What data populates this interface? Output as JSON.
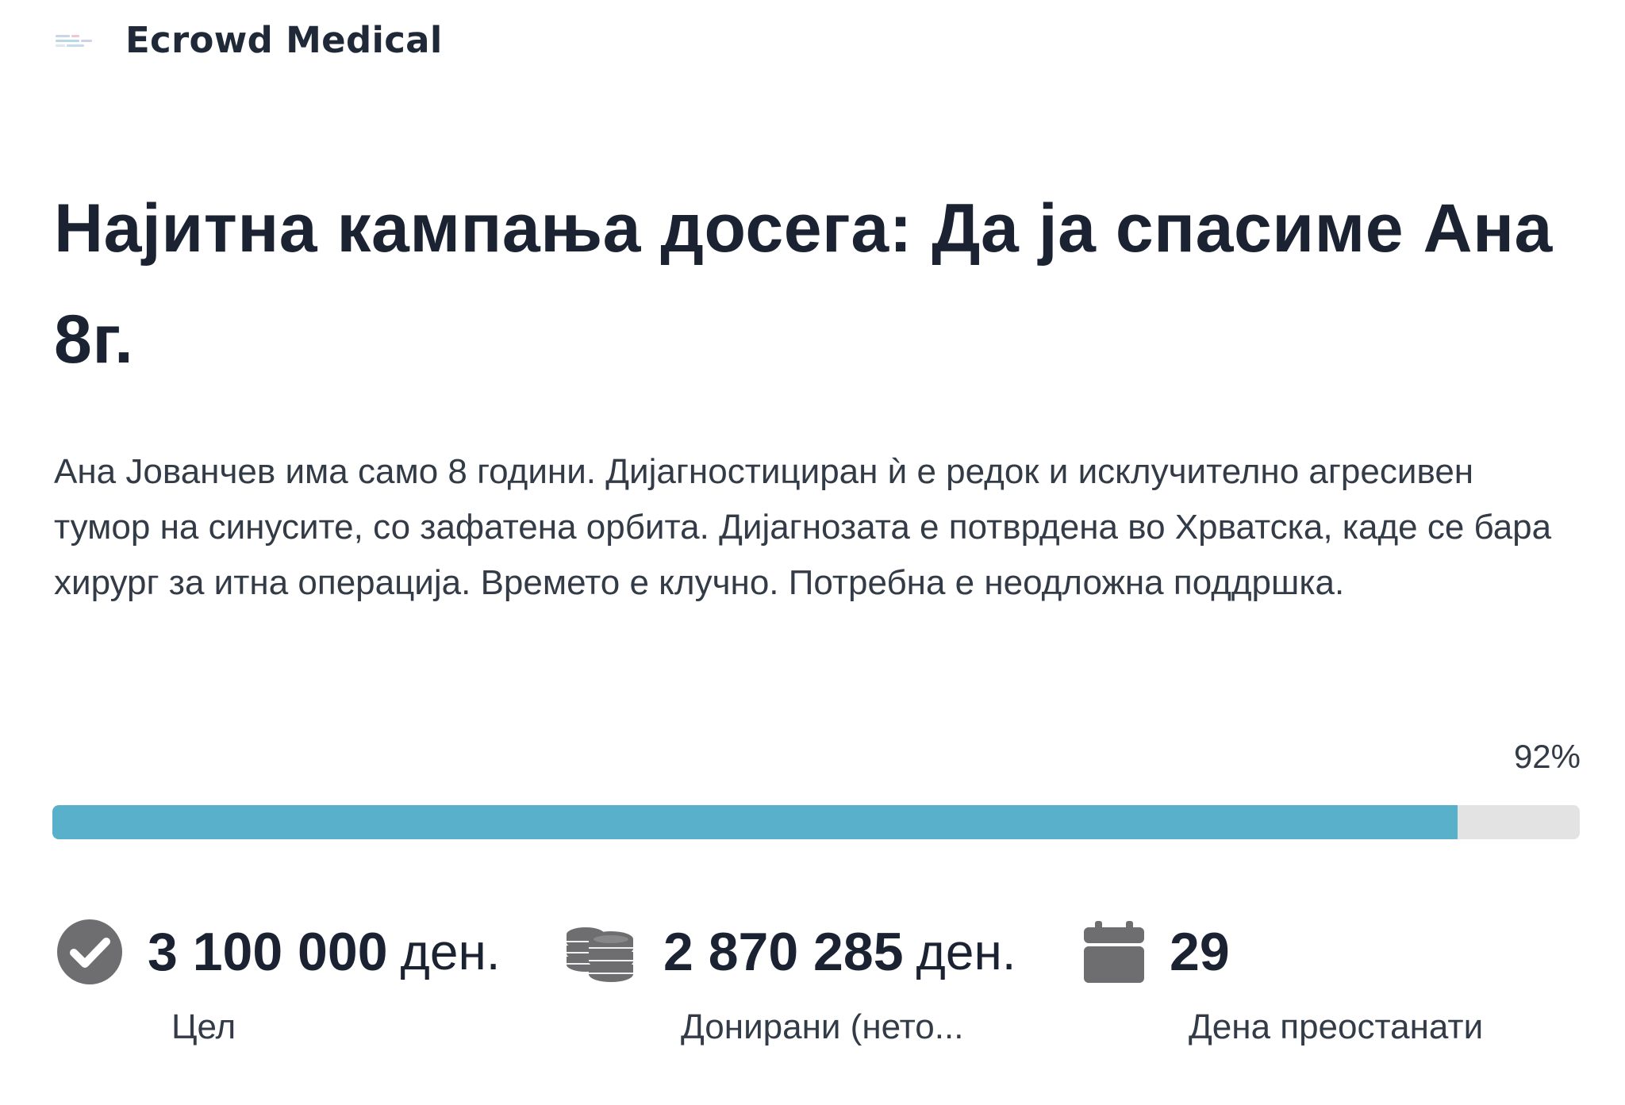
{
  "header": {
    "brand": "Ecrowd Medical"
  },
  "campaign": {
    "title": "Најитна кампања досега: Да ја спасиме Ана 8г.",
    "description": "Ана Јованчев има само 8 години. Дијагностициран ѝ е редок и исклучително агресивен тумор на синусите, со зафатена орбита. Дијагнозата е потврдена во Хрватска, каде се бара хирург за итна операција. Времето е клучно. Потребна е неодложна поддршка.",
    "progress_label": "92%",
    "progress_fraction": 0.92
  },
  "stats": {
    "goal": {
      "icon": "check-circle-icon",
      "value": "3 100 000",
      "unit": "ден.",
      "label": "Цел"
    },
    "donated": {
      "icon": "coins-stack-icon",
      "value": "2 870 285",
      "unit": "ден.",
      "label": "Донирани (нето..."
    },
    "days": {
      "icon": "calendar-icon",
      "value": "29",
      "label": "Дена преостанати"
    }
  },
  "colors": {
    "progress_fill": "#58b0ca",
    "progress_track": "#e3e3e3",
    "icon_gray": "#6e6e70",
    "title_text": "#1b2333"
  }
}
